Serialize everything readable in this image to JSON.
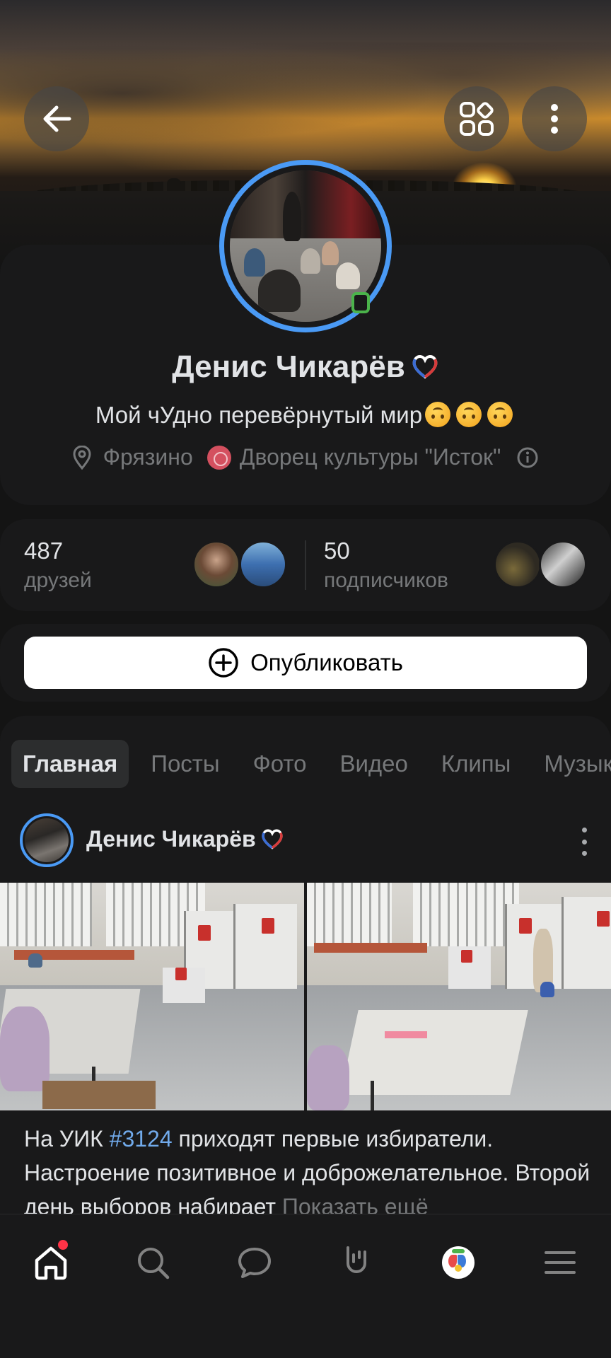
{
  "profile": {
    "name": "Денис Чикарёв",
    "status": "Мой чУдно перевёрнутый мир",
    "city": "Фрязино",
    "organization": "Дворец культуры \"Исток\""
  },
  "stats": {
    "friends_count": "487",
    "friends_label": "друзей",
    "followers_count": "50",
    "followers_label": "подписчиков"
  },
  "actions": {
    "publish_label": "Опубликовать"
  },
  "tabs": [
    {
      "label": "Главная",
      "active": true
    },
    {
      "label": "Посты",
      "active": false
    },
    {
      "label": "Фото",
      "active": false
    },
    {
      "label": "Видео",
      "active": false
    },
    {
      "label": "Клипы",
      "active": false
    },
    {
      "label": "Музыка",
      "active": false
    }
  ],
  "post": {
    "author": "Денис Чикарёв",
    "text_before_tag": "На УИК ",
    "hashtag": "#3124",
    "text_after_tag": " приходят первые избиратели. Настроение позитивное и доброжелательное. Второй день выборов набирает",
    "show_more": "Показать ещё"
  },
  "bottom_nav": [
    {
      "icon": "home-icon",
      "active": true,
      "badge": true
    },
    {
      "icon": "search-icon",
      "active": false
    },
    {
      "icon": "messages-icon",
      "active": false
    },
    {
      "icon": "clips-icon",
      "active": false
    },
    {
      "icon": "miniapp-icon",
      "active": false
    },
    {
      "icon": "menu-icon",
      "active": false
    }
  ],
  "colors": {
    "background": "#141414",
    "card": "#19191a",
    "accent": "#4a9af5",
    "link": "#71aaeb",
    "secondary_text": "#76787a",
    "online": "#4bb34b",
    "badge": "#ff3347"
  }
}
